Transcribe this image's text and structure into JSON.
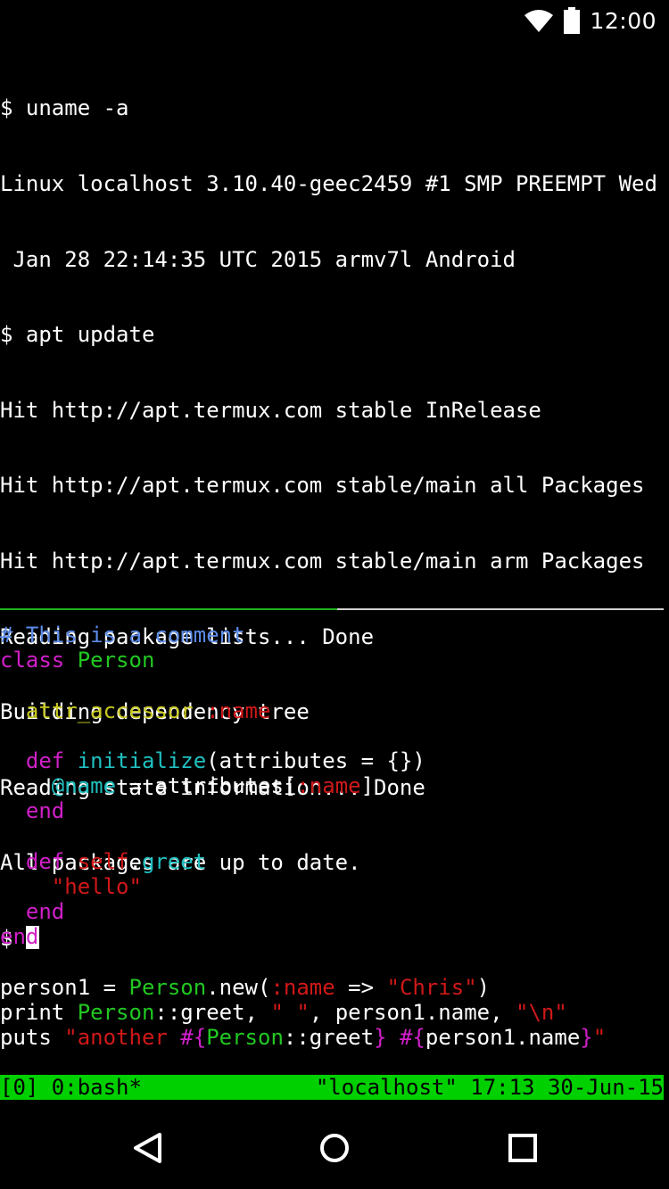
{
  "status_bar": {
    "time": "12:00",
    "icons": [
      "wifi-icon",
      "battery-icon"
    ]
  },
  "terminal_top": {
    "lines": [
      "$ uname -a",
      "Linux localhost 3.10.40-geec2459 #1 SMP PREEMPT Wed",
      " Jan 28 22:14:35 UTC 2015 armv7l Android",
      "$ apt update",
      "Hit http://apt.termux.com stable InRelease",
      "Hit http://apt.termux.com stable/main all Packages",
      "Hit http://apt.termux.com stable/main arm Packages",
      "Reading package lists... Done",
      "Building dependency tree",
      "Reading state information... Done",
      "All packages are up to date."
    ],
    "prompt": "$ "
  },
  "code_pane": {
    "lines": [
      [
        {
          "t": "# This is a comment",
          "c": "comment"
        }
      ],
      [
        {
          "t": "class ",
          "c": "keyword"
        },
        {
          "t": "Person",
          "c": "const"
        }
      ],
      [],
      [
        {
          "t": "  "
        },
        {
          "t": "attr_accessor ",
          "c": "method"
        },
        {
          "t": ":name",
          "c": "symbol"
        }
      ],
      [],
      [
        {
          "t": "  "
        },
        {
          "t": "def ",
          "c": "keyword"
        },
        {
          "t": "initialize",
          "c": "func"
        },
        {
          "t": "(attributes = {})"
        }
      ],
      [
        {
          "t": "    "
        },
        {
          "t": "@name",
          "c": "func"
        },
        {
          "t": " = attributes["
        },
        {
          "t": ":name",
          "c": "symbol"
        },
        {
          "t": "]"
        }
      ],
      [
        {
          "t": "  "
        },
        {
          "t": "end",
          "c": "keyword"
        }
      ],
      [],
      [
        {
          "t": "  "
        },
        {
          "t": "def ",
          "c": "keyword"
        },
        {
          "t": "self",
          "c": "symbol"
        },
        {
          "t": "."
        },
        {
          "t": "greet",
          "c": "func"
        }
      ],
      [
        {
          "t": "    "
        },
        {
          "t": "\"hello\"",
          "c": "symbol"
        }
      ],
      [
        {
          "t": "  "
        },
        {
          "t": "end",
          "c": "keyword"
        }
      ],
      [
        {
          "t": "end",
          "c": "keyword"
        }
      ],
      [],
      [
        {
          "t": "person1 = "
        },
        {
          "t": "Person",
          "c": "const"
        },
        {
          "t": ".new("
        },
        {
          "t": ":name",
          "c": "symbol"
        },
        {
          "t": " => "
        },
        {
          "t": "\"Chris\"",
          "c": "symbol"
        },
        {
          "t": ")"
        }
      ],
      [
        {
          "t": "print "
        },
        {
          "t": "Person",
          "c": "const"
        },
        {
          "t": "::greet, "
        },
        {
          "t": "\" \"",
          "c": "symbol"
        },
        {
          "t": ", person1.name, "
        },
        {
          "t": "\"\\n\"",
          "c": "symbol"
        }
      ],
      [
        {
          "t": "puts "
        },
        {
          "t": "\"another ",
          "c": "symbol"
        },
        {
          "t": "#{",
          "c": "keyword"
        },
        {
          "t": "Person",
          "c": "const"
        },
        {
          "t": "::greet"
        },
        {
          "t": "}",
          "c": "keyword"
        },
        {
          "t": " ",
          "c": "symbol"
        },
        {
          "t": "#{",
          "c": "keyword"
        },
        {
          "t": "person1.name"
        },
        {
          "t": "}",
          "c": "keyword"
        },
        {
          "t": "\"",
          "c": "symbol"
        }
      ]
    ]
  },
  "tmux_status": {
    "left": "[0] 0:bash*",
    "right": "\"localhost\" 17:13 30-Jun-15"
  },
  "nav_bar": {
    "buttons": [
      "back-icon",
      "home-icon",
      "recents-icon"
    ]
  },
  "colors": {
    "background": "#000000",
    "tmux_bar": "#00d000",
    "comment": "#5c8ce8",
    "keyword": "#d020c8",
    "constant": "#22c822",
    "method": "#c8c820",
    "symbol": "#d01818",
    "function": "#20c0c0"
  }
}
